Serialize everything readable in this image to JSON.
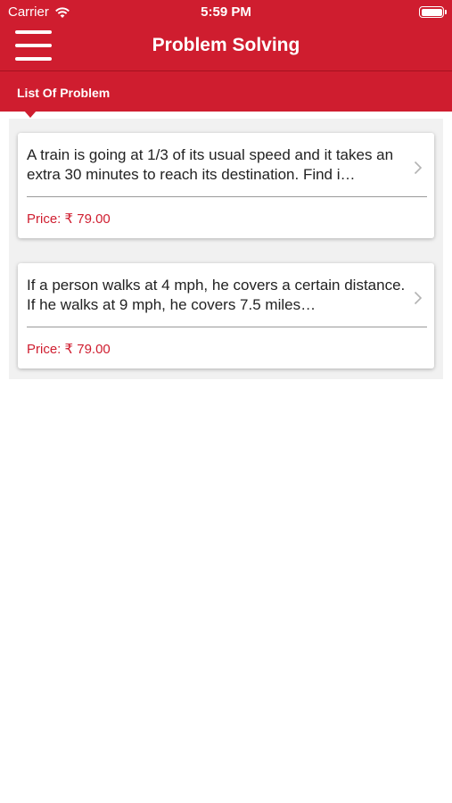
{
  "status_bar": {
    "carrier": "Carrier",
    "time": "5:59 PM",
    "wifi_icon": "wifi-icon",
    "battery_icon": "battery-icon"
  },
  "navbar": {
    "title": "Problem Solving",
    "menu_icon": "hamburger-menu-icon"
  },
  "section": {
    "label": "List Of Problem"
  },
  "problems": [
    {
      "text": "A train is going at 1/3 of its usual speed and it takes an extra 30 minutes to reach its destination. Find i…",
      "price": "Price: ₹ 79.00"
    },
    {
      "text": "If a person walks at 4 mph, he covers a certain distance. If he walks at 9 mph, he covers 7.5 miles…",
      "price": "Price: ₹ 79.00"
    }
  ],
  "colors": {
    "brand_red": "#cf1d2f",
    "panel_bg": "#f1f1f1"
  }
}
